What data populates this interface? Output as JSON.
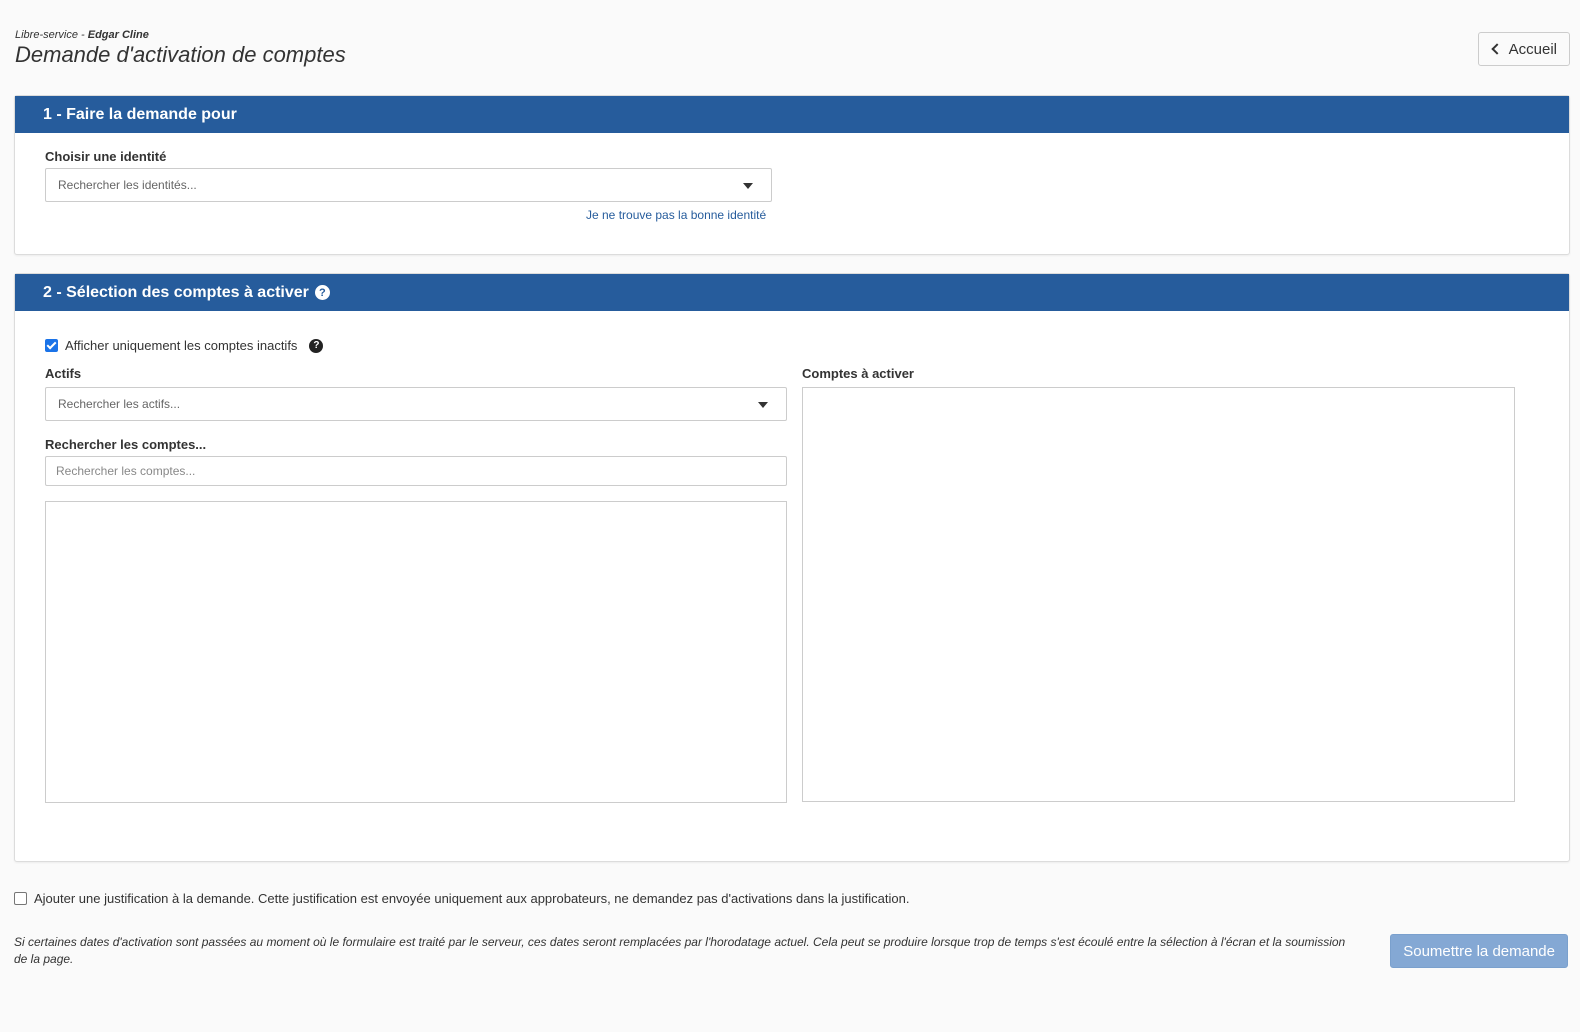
{
  "header": {
    "crumb_prefix": "Libre-service - ",
    "crumb_user": "Edgar Cline",
    "title": "Demande d'activation de comptes",
    "home_button": "Accueil"
  },
  "section1": {
    "heading": "1 - Faire la demande pour",
    "identity_label": "Choisir une identité",
    "identity_placeholder": "Rechercher les identités...",
    "not_found_link": "Je ne trouve pas la bonne identité"
  },
  "section2": {
    "heading": "2 - Sélection des comptes à activer",
    "only_inactive_label": "Afficher uniquement les comptes inactifs",
    "only_inactive_checked": true,
    "assets_label": "Actifs",
    "assets_placeholder": "Rechercher les actifs...",
    "accounts_search_label": "Rechercher les comptes...",
    "accounts_search_placeholder": "Rechercher les comptes...",
    "to_activate_label": "Comptes à activer"
  },
  "footer": {
    "justification_label": "Ajouter une justification à la demande. Cette justification est envoyée uniquement aux approbateurs, ne demandez pas d'activations dans la justification.",
    "justification_checked": false,
    "note": "Si certaines dates d'activation sont passées au moment où le formulaire est traité par le serveur, ces dates seront remplacées par l'horodatage actuel. Cela peut se produire lorsque trop de temps s'est écoulé entre la sélection à l'écran et la soumission de la page.",
    "submit_label": "Soumettre la demande"
  },
  "colors": {
    "panel_header": "#265c9c",
    "link": "#265c9c",
    "submit_disabled": "#84a8d4",
    "checkbox_on": "#1a73e8"
  },
  "icons": {
    "back": "chevron-left-icon",
    "help": "question-circle-icon",
    "dropdown": "caret-down-icon"
  }
}
